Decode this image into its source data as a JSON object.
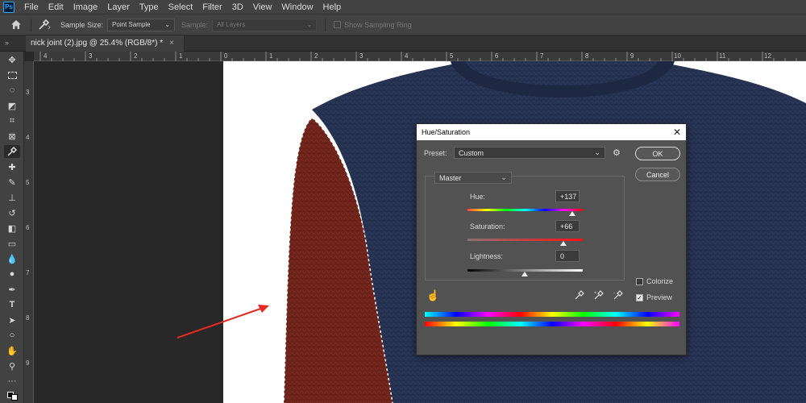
{
  "app": {
    "logo": "Ps"
  },
  "menu": [
    "File",
    "Edit",
    "Image",
    "Layer",
    "Type",
    "Select",
    "Filter",
    "3D",
    "View",
    "Window",
    "Help"
  ],
  "options_bar": {
    "sample_size_label": "Sample Size:",
    "sample_size_value": "Point Sample",
    "sample_label": "Sample:",
    "sample_value": "All Layers",
    "show_ring_label": "Show Sampling Ring"
  },
  "document_tab": {
    "title": "nick joint (2).jpg @ 25.4% (RGB/8*) *",
    "close": "×"
  },
  "ruler_h": [
    "4",
    "3",
    "2",
    "1",
    "0",
    "1",
    "2",
    "3",
    "4",
    "5",
    "6",
    "7",
    "8",
    "9",
    "10",
    "11",
    "12"
  ],
  "ruler_v": [
    "3",
    "4",
    "5",
    "6",
    "7",
    "8",
    "9"
  ],
  "dialog": {
    "title": "Hue/Saturation",
    "close": "✕",
    "preset_label": "Preset:",
    "preset_value": "Custom",
    "channel": "Master",
    "hue_label": "Hue:",
    "hue_value": "+137",
    "saturation_label": "Saturation:",
    "saturation_value": "+66",
    "lightness_label": "Lightness:",
    "lightness_value": "0",
    "ok": "OK",
    "cancel": "Cancel",
    "colorize_label": "Colorize",
    "colorize_checked": false,
    "preview_label": "Preview",
    "preview_checked": true
  },
  "colors": {
    "sweater": "#24304e",
    "sleeve": "#6b2218",
    "arrow": "#e32b22",
    "selection": "#ffffff"
  }
}
